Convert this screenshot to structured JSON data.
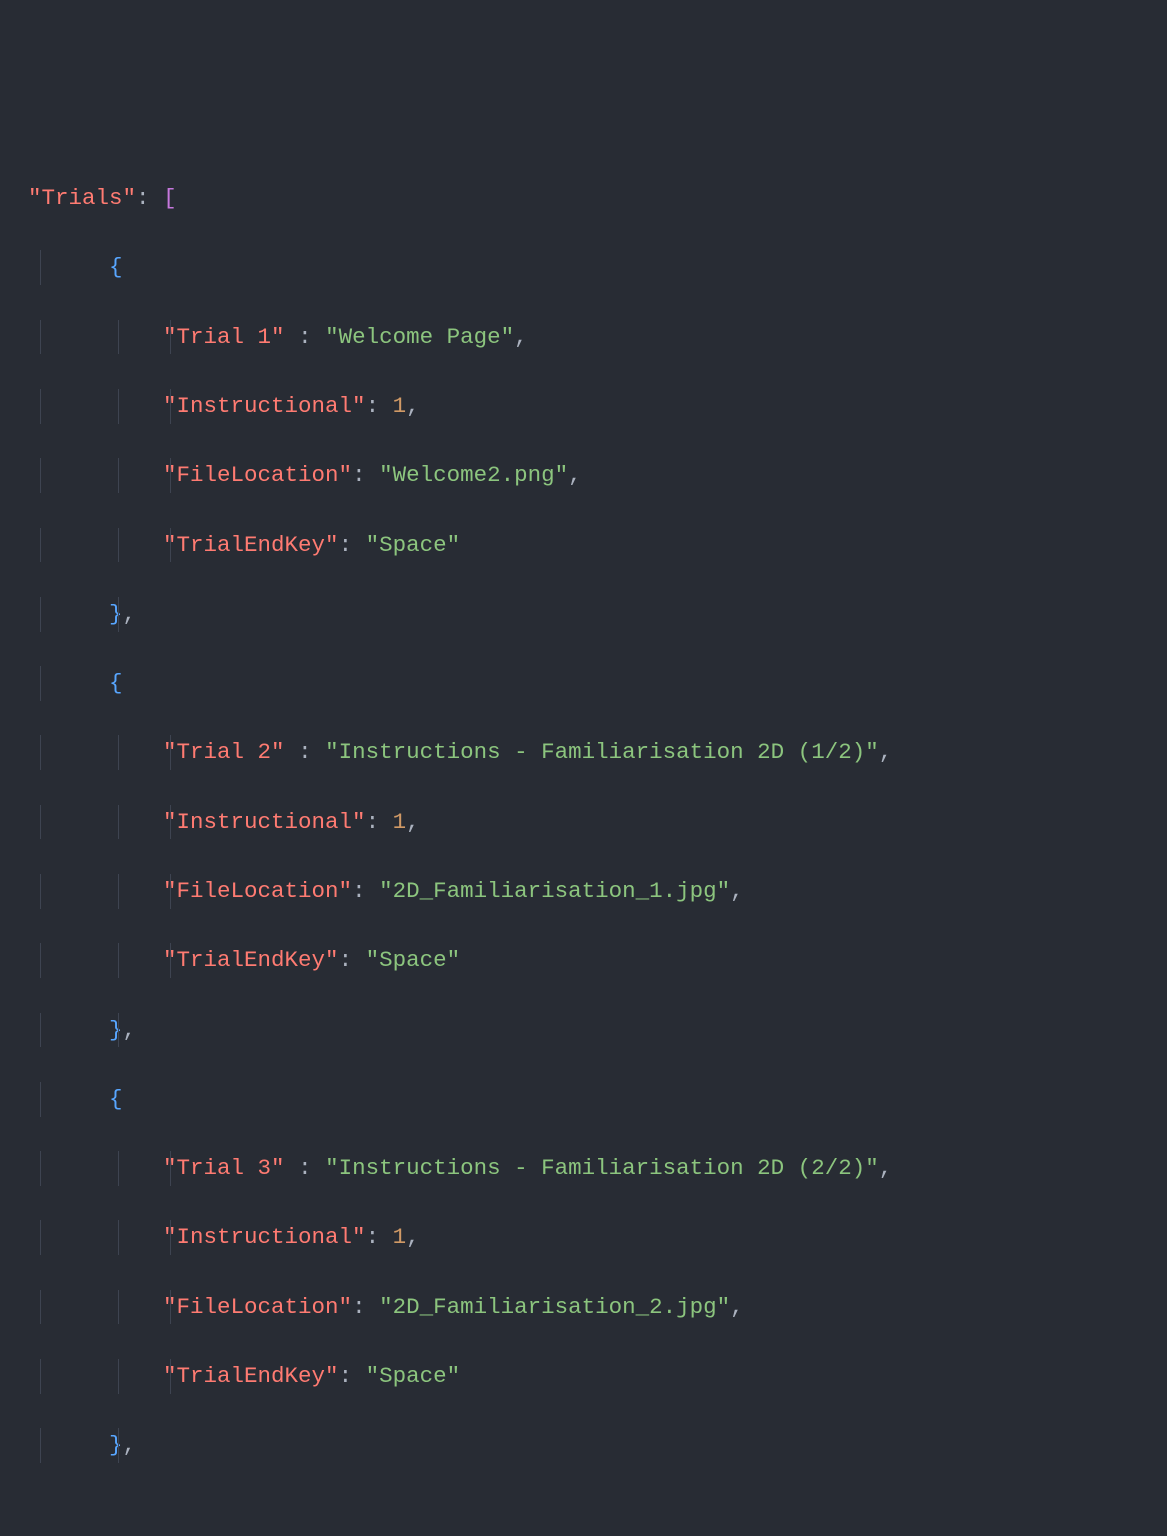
{
  "code": {
    "rootKey": "\"Trials\"",
    "colon": ":",
    "openArray": "[",
    "openBrace": "{",
    "closeBrace": "}",
    "comma": ",",
    "trials": [
      {
        "keyTrial": "\"Trial 1\"",
        "valTrial": "\"Welcome Page\"",
        "keyInstr": "\"Instructional\"",
        "valInstr": "1",
        "keyFile": "\"FileLocation\"",
        "valFile": "\"Welcome2.png\"",
        "keyEnd": "\"TrialEndKey\"",
        "valEnd": "\"Space\""
      },
      {
        "keyTrial": "\"Trial 2\"",
        "valTrial": "\"Instructions - Familiarisation 2D (1/2)\"",
        "keyInstr": "\"Instructional\"",
        "valInstr": "1",
        "keyFile": "\"FileLocation\"",
        "valFile": "\"2D_Familiarisation_1.jpg\"",
        "keyEnd": "\"TrialEndKey\"",
        "valEnd": "\"Space\""
      },
      {
        "keyTrial": "\"Trial 3\"",
        "valTrial": "\"Instructions - Familiarisation 2D (2/2)\"",
        "keyInstr": "\"Instructional\"",
        "valInstr": "1",
        "keyFile": "\"FileLocation\"",
        "valFile": "\"2D_Familiarisation_2.jpg\"",
        "keyEnd": "\"TrialEndKey\"",
        "valEnd": "\"Space\""
      }
    ]
  }
}
